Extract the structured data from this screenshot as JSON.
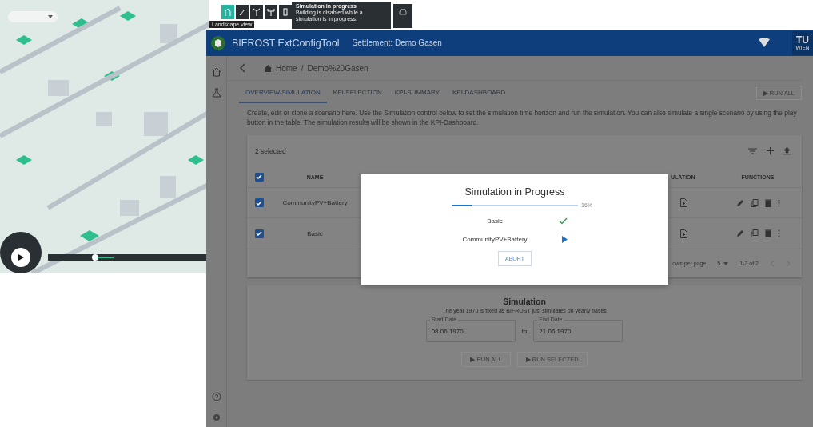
{
  "map_view": {
    "toolbar_tooltip": "Landscape view",
    "notice": {
      "title": "Simulation in progress",
      "text": "Building is disabled while a simulation is in progress."
    }
  },
  "app": {
    "title": "BIFROST ExtConfigTool",
    "settlement": "Settlement: Demo Gasen",
    "logo_text": "TU",
    "logo_subtext": "WIEN"
  },
  "breadcrumb": [
    "Home",
    "Demo%20Gasen"
  ],
  "breadcrumb_separator": "/",
  "tabs": [
    {
      "label": "OVERVIEW-SIMULATION",
      "selected": true
    },
    {
      "label": "KPI-SELECTION",
      "selected": false
    },
    {
      "label": "KPI-SUMMARY",
      "selected": false
    },
    {
      "label": "KPI-DASHBOARD",
      "selected": false
    }
  ],
  "run_all_top": {
    "label": "▶ RUN ALL",
    "disabled": true
  },
  "description": "Create, edit or clone a scenario here. Use the Simulation control below to set the simulation time horizon and run the simulation. You can also simulate a single scenario by using the play button in the table. The simulation results will be shown in the KPI-Dashboard.",
  "table": {
    "selection_text": "2 selected",
    "all_checked": true,
    "columns": [
      "NAME",
      "ULATION",
      "FUNCTIONS"
    ],
    "rows": [
      {
        "name": "CommunityPV+Battery",
        "checked": true
      },
      {
        "name": "Basic",
        "checked": true
      }
    ],
    "rows_per_page_label": "ows per page",
    "rows_per_page": "5",
    "range": "1-2 of 2"
  },
  "simulation": {
    "title": "Simulation",
    "subtitle": "The year 1970 is fixed as BIFROST just simulates on yearly bases",
    "start_label": "Start Date",
    "start": "08.06.1970",
    "to": "to",
    "end_label": "End Date",
    "end": "21.06.1970",
    "buttons": [
      {
        "label": "▶ RUN ALL",
        "disabled": true
      },
      {
        "label": "▶ RUN SELECTED",
        "disabled": true
      }
    ]
  },
  "dialog": {
    "title": "Simulation in Progress",
    "level": 0.16,
    "percent": "16%",
    "items": [
      {
        "name": "Basic",
        "kind": "done"
      },
      {
        "name": "CommunityPV+Battery",
        "kind": "running"
      }
    ],
    "abort": "ABORT"
  }
}
